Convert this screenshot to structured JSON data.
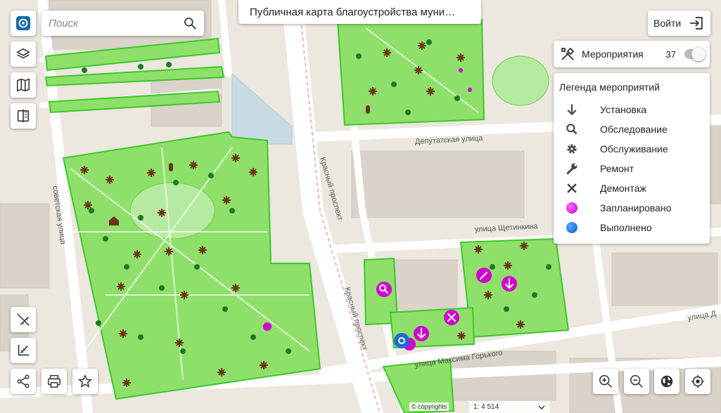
{
  "search": {
    "placeholder": "Поиск"
  },
  "title": "Публичная карта благоустройства муни…",
  "login_label": "Войти",
  "events": {
    "label": "Мероприятия",
    "count": "37",
    "toggle_on": false
  },
  "legend": {
    "title": "Легенда мероприятий",
    "items": [
      {
        "label": "Установка",
        "icon": "arrow-down-icon"
      },
      {
        "label": "Обследование",
        "icon": "magnifier-icon"
      },
      {
        "label": "Обслуживание",
        "icon": "gear-icon"
      },
      {
        "label": "Ремонт",
        "icon": "wrench-icon"
      },
      {
        "label": "Демонтаж",
        "icon": "cross-icon"
      },
      {
        "label": "Запланировано",
        "icon": "planned-dot",
        "color": "#d000d0"
      },
      {
        "label": "Выполнено",
        "icon": "done-dot",
        "color": "#1a6fd0"
      }
    ]
  },
  "map": {
    "streets": [
      "Депутатская улица",
      "Красный проспект",
      "Красный проспект",
      "советская улица",
      "улица Щетинкина",
      "улица Максима Горького",
      "улица Д"
    ],
    "colors": {
      "park": "#8ee06a",
      "park_border": "#3cc828",
      "road": "#ffffff",
      "building": "#d9d3c9",
      "ground": "#ece7df",
      "planned": "#d000d0",
      "done": "#1a6fd0"
    }
  },
  "scale": "1: 4 514",
  "copyright": "© copyrights"
}
